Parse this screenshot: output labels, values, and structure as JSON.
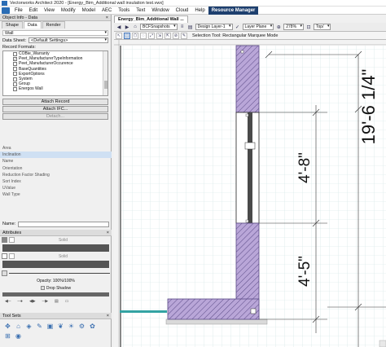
{
  "window": {
    "title": "Vectorworks Architect 2020 - [Energy_Bim_Additional wall insulation test.vwx]"
  },
  "menu": {
    "items": [
      "File",
      "Edit",
      "View",
      "Modify",
      "Model",
      "AEC",
      "Tools",
      "Text",
      "Window",
      "Cloud",
      "Help",
      "Resource Manager"
    ]
  },
  "obj_info": {
    "title": "Object Info - Data",
    "tabs": [
      "Shape",
      "Data",
      "Render"
    ],
    "object_type": "Wall",
    "data_sheet_label": "Data Sheet:",
    "data_sheet_value": "<Default Settings>",
    "record_formats_label": "Record Formats:",
    "records": [
      {
        "label": "COBie_Warranty",
        "checked": false
      },
      {
        "label": "Peet_ManufacturerTypeInformation",
        "checked": true
      },
      {
        "label": "Peet_ManufacturerOccurence",
        "checked": false
      },
      {
        "label": "BaseQuantities",
        "checked": false
      },
      {
        "label": "ExportOptions",
        "checked": false
      },
      {
        "label": "System",
        "checked": false
      },
      {
        "label": "Group",
        "checked": false
      },
      {
        "label": "Energos Wall",
        "checked": false
      }
    ],
    "buttons": {
      "attach_record": "Attach Record",
      "attach_ifc": "Attach IFC...",
      "detach": "Detach..."
    },
    "params": [
      "Area",
      "Inclination",
      "Name",
      "Orientation",
      "Reduction Factor Shading",
      "Sort Index",
      "UValue",
      "Wall Type"
    ],
    "name_label": "Name:"
  },
  "attributes": {
    "title": "Attributes",
    "fill_label": "Solid",
    "pen_label": "Solid",
    "opacity": "Opacity: 100%/100%",
    "drop_shadow": "Drop Shadow"
  },
  "tool_sets": {
    "title": "Tool Sets"
  },
  "doc": {
    "tab": "Energy_Bim_Additional Wall ...",
    "snapshot": "BCFSnapshots",
    "layer": "Design Layer-1",
    "plane": "Layer Plane",
    "zoom": "278%",
    "view": "Top/",
    "mode_text": "Selection Tool: Rectangular Marquee Mode"
  },
  "drawing": {
    "dims": [
      "19'-6 1/4\"",
      "4'-8\"",
      "4'-5\""
    ]
  },
  "colors": {
    "menu_active": "#1d3f6e",
    "wall_fill": "#b9a6d8",
    "wall_stroke": "#5a4a86",
    "window": "#3a3a3a",
    "highlight": "#cfe0f3"
  }
}
